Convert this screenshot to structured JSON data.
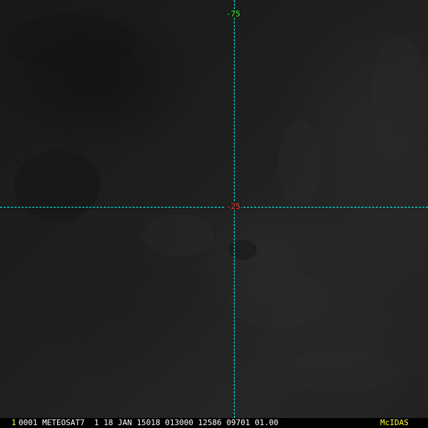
{
  "image": {
    "background_color": "#1c1c1c",
    "grid_color": "#00ffff"
  },
  "grid_labels": {
    "top": {
      "text": "-75",
      "color": "#33ff33"
    },
    "center": {
      "text": "-25",
      "color": "#ff3333"
    }
  },
  "status_bar": {
    "frame_number": "1",
    "header": "0001 METEOSAT7  1 18 JAN 15018 013000 12586 09701 01.00",
    "brand": "McIDAS",
    "frame_color": "#ffff33",
    "brand_color": "#ffff33"
  }
}
